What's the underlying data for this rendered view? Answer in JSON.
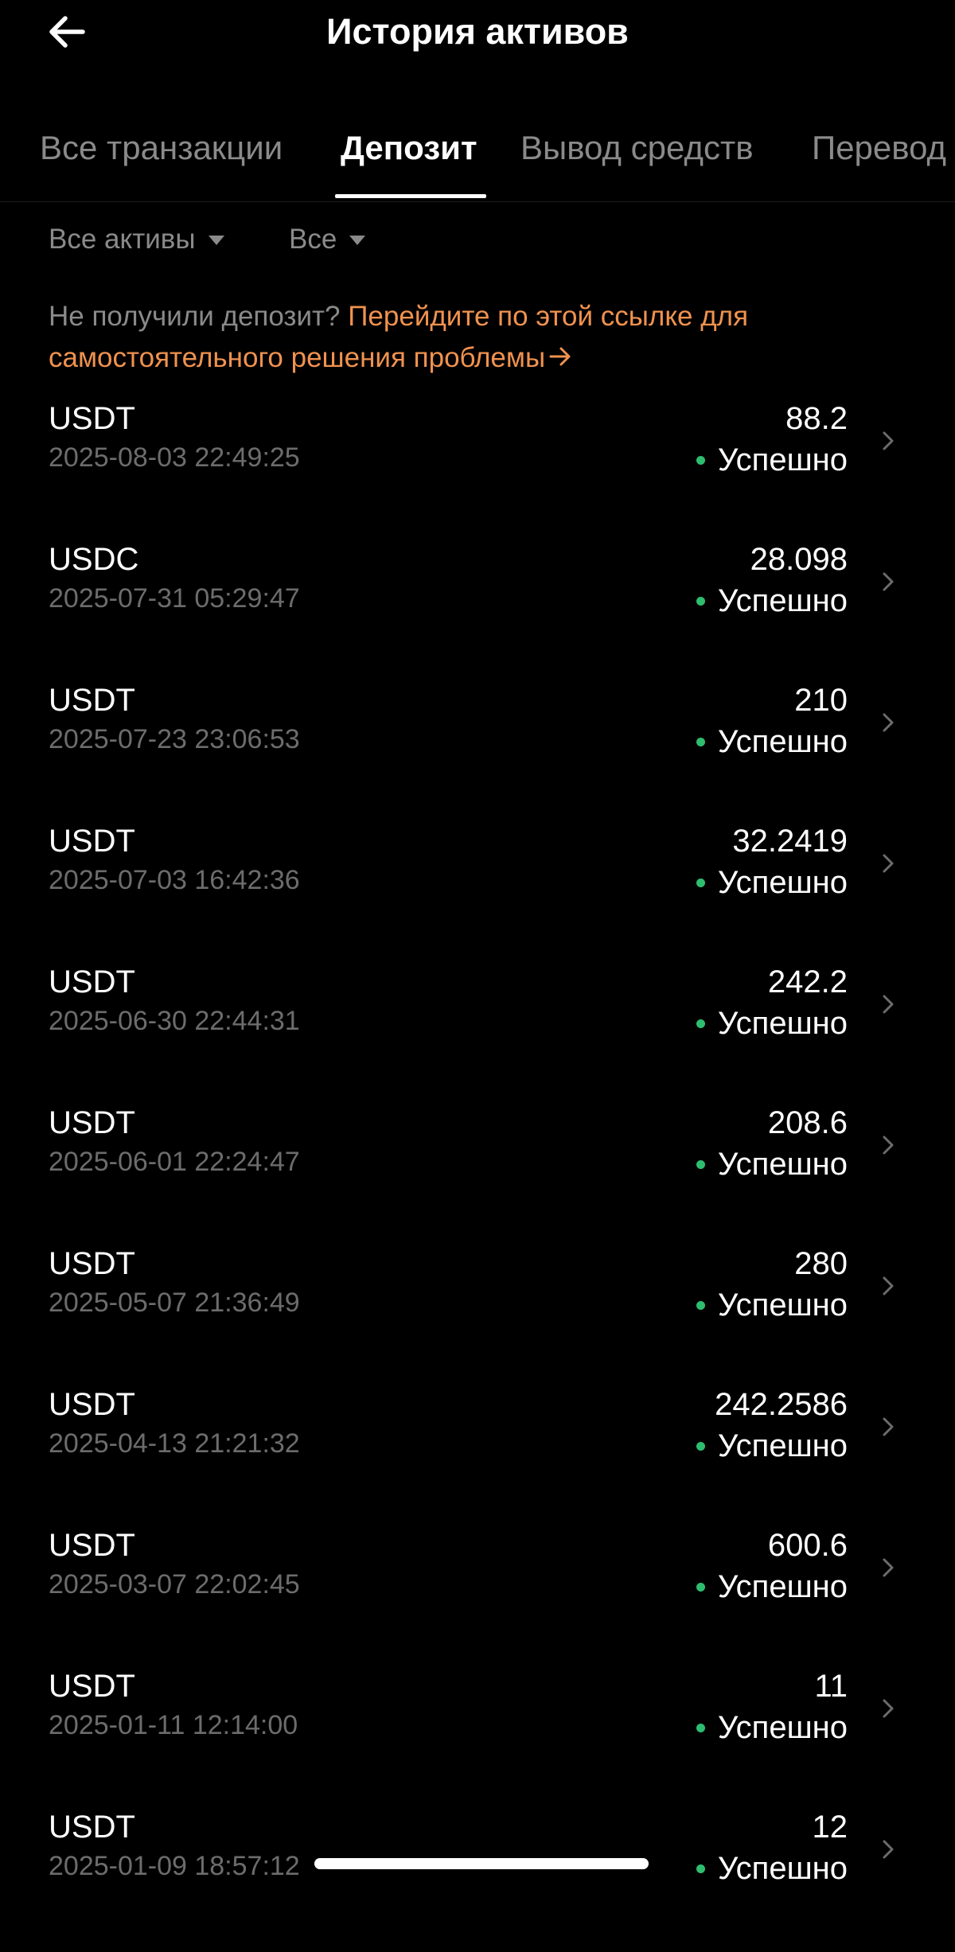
{
  "header": {
    "title": "История активов",
    "back_icon": "arrow-left-icon"
  },
  "tabs": [
    {
      "label": "Все транзакции",
      "active": false
    },
    {
      "label": "Депозит",
      "active": true
    },
    {
      "label": "Вывод средств",
      "active": false
    },
    {
      "label": "Перевод",
      "active": false
    }
  ],
  "filters": {
    "asset": "Все активы",
    "status": "Все"
  },
  "notice": {
    "text": "Не получили депозит?",
    "link": "Перейдите по этой ссылке для самостоятельного решения проблемы",
    "link_icon": "arrow-right-icon"
  },
  "colors": {
    "background": "#000000",
    "accent": "#f0924f",
    "success": "#2ebd6f",
    "muted": "#8a8a8a"
  },
  "transactions": [
    {
      "asset": "USDT",
      "time": "2025-08-03 22:49:25",
      "amount": "88.2",
      "status": "Успешно"
    },
    {
      "asset": "USDC",
      "time": "2025-07-31 05:29:47",
      "amount": "28.098",
      "status": "Успешно"
    },
    {
      "asset": "USDT",
      "time": "2025-07-23 23:06:53",
      "amount": "210",
      "status": "Успешно"
    },
    {
      "asset": "USDT",
      "time": "2025-07-03 16:42:36",
      "amount": "32.2419",
      "status": "Успешно"
    },
    {
      "asset": "USDT",
      "time": "2025-06-30 22:44:31",
      "amount": "242.2",
      "status": "Успешно"
    },
    {
      "asset": "USDT",
      "time": "2025-06-01 22:24:47",
      "amount": "208.6",
      "status": "Успешно"
    },
    {
      "asset": "USDT",
      "time": "2025-05-07 21:36:49",
      "amount": "280",
      "status": "Успешно"
    },
    {
      "asset": "USDT",
      "time": "2025-04-13 21:21:32",
      "amount": "242.2586",
      "status": "Успешно"
    },
    {
      "asset": "USDT",
      "time": "2025-03-07 22:02:45",
      "amount": "600.6",
      "status": "Успешно"
    },
    {
      "asset": "USDT",
      "time": "2025-01-11 12:14:00",
      "amount": "11",
      "status": "Успешно"
    },
    {
      "asset": "USDT",
      "time": "2025-01-09 18:57:12",
      "amount": "12",
      "status": "Успешно"
    }
  ]
}
